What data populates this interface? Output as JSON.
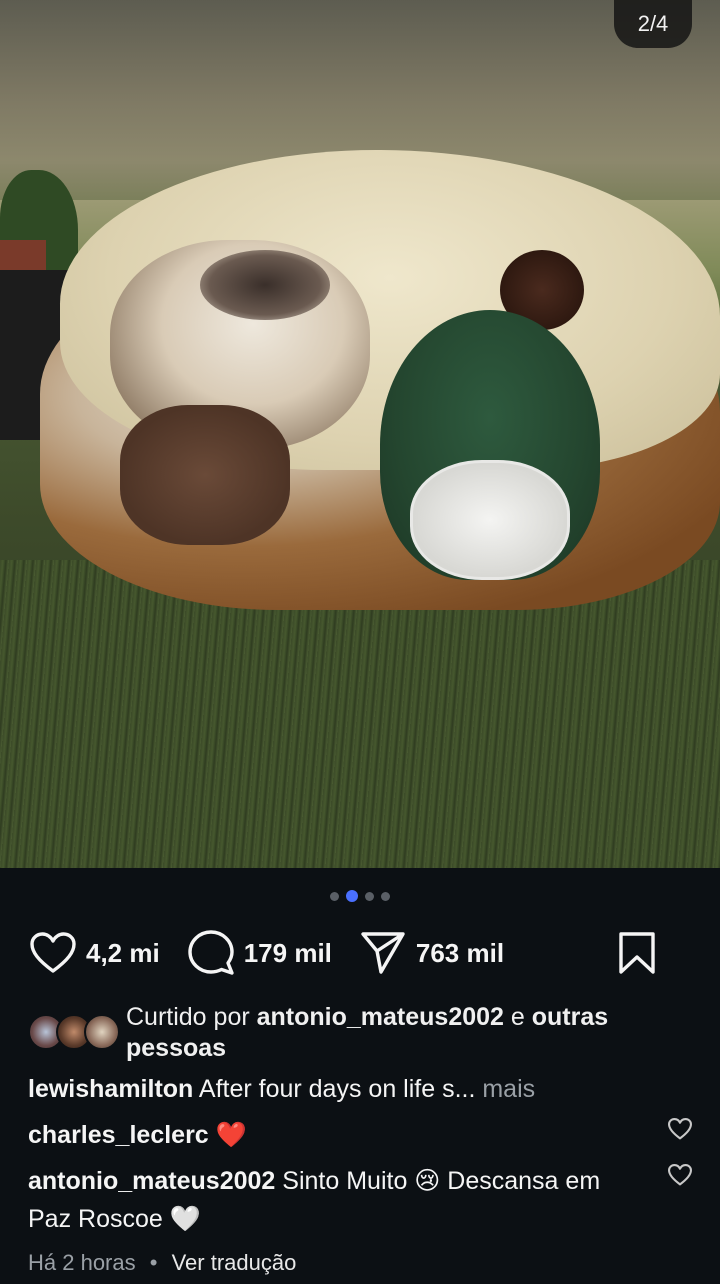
{
  "post": {
    "counter": "2/4",
    "carousel": {
      "total": 4,
      "active_index": 1
    }
  },
  "actions": {
    "likes": "4,2 mi",
    "comments": "179 mil",
    "shares": "763 mil"
  },
  "liked_by": {
    "prefix": "Curtido por",
    "user": "antonio_mateus2002",
    "conj": "e",
    "others": "outras pessoas"
  },
  "caption": {
    "user": "lewishamilton",
    "text": "After four days on life s...",
    "more": "mais"
  },
  "comments": [
    {
      "user": "charles_leclerc",
      "text": "❤️"
    },
    {
      "user": "antonio_mateus2002",
      "text": "Sinto Muito 😢 Descansa em Paz Roscoe 🤍"
    }
  ],
  "meta": {
    "time": "Há 2 horas",
    "separator": "•",
    "translate": "Ver tradução"
  },
  "colors": {
    "background": "#0c1014",
    "accent_dot": "#4a70ff",
    "muted": "#9aa0a6"
  }
}
